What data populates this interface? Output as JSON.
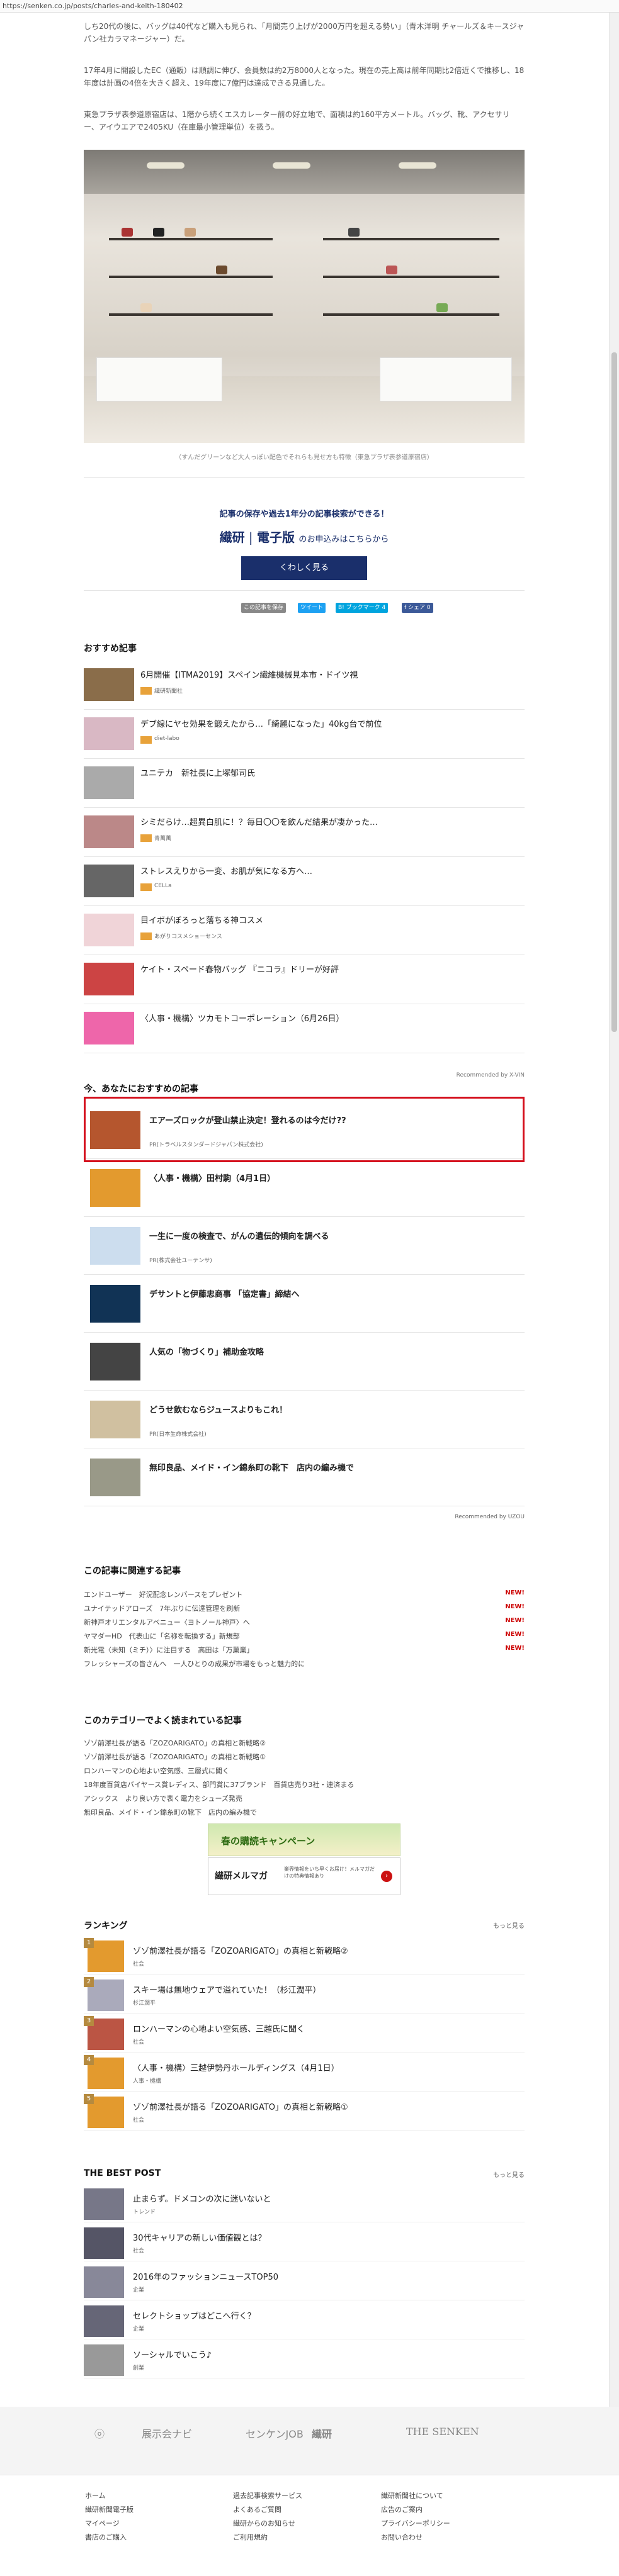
{
  "browser": {
    "url": "https://senken.co.jp/posts/charles-and-keith-180402"
  },
  "article": {
    "p1": "しち20代の後に、バッグは40代など購入も見られ、「月間売り上げが2000万円を超える勢い」（青木洋明 チャールズ＆キースジャパン社カラマネージャー）だ。",
    "p2": "17年4月に開設したEC（通販）は順調に伸び、会員数は約2万8000人となった。現在の売上高は前年同期比2倍近くで推移し、18年度は計画の4倍を大きく超え、19年度に7億円は達成できる見通した。",
    "p3": "東急プラザ表参道原宿店は、1階から続くエスカレーター前の好立地で、面積は約160平方メートル。バッグ、靴、アクセサリー、アイウエアで2405KU（在庫最小管理単位）を扱う。",
    "caption": "（すんだグリーンなど大人っぽい配色でそれらも見せ方も特徴（東急プラザ表参道原宿店）"
  },
  "promo": {
    "line1": "記事の保存や過去1年分の記事検索ができる！",
    "brand": "繊研",
    "brand2": "電子版",
    "line2_suffix": "のお申込みはこちらから",
    "button": "くわしく見る"
  },
  "share": {
    "scrap": "この記事を保存",
    "tweet": "ツイート",
    "hatena": "B! ブックマーク 4",
    "facebook": "f シェア 0"
  },
  "recommend": {
    "title": "おすすめ記事",
    "items": [
      {
        "title": "6月開催【ITMA2019】スペイン繊維機械見本市・ドイツ視",
        "src": "繊研新聞社"
      },
      {
        "title": "デブ線にヤセ効果を鍛えたから…「綺麗になった」40kg台で前位",
        "src": "diet-labo"
      },
      {
        "title": "ユニテカ　新社長に上塚郁司氏",
        "src": ""
      },
      {
        "title": "シミだらけ…超異白肌に！？毎日〇〇を飲んだ結果が凄かった…",
        "src": "青萬萬"
      },
      {
        "title": "ストレスえりから一変、お肌が気になる方へ…",
        "src": "CELLa"
      },
      {
        "title": "目イボがぼろっと落ちる神コスメ",
        "src": "あがりコスメショーセンス"
      },
      {
        "title": "ケイト・スペード春物バッグ 『ニコラ』ドリーが好評",
        "src": ""
      },
      {
        "title": "〈人事・機構〉ツカモトコーポレーション（6月26日）",
        "src": ""
      }
    ],
    "powered": "Recommended by  X-VIN"
  },
  "osusume": {
    "title": "今、あなたにおすすめの記事",
    "items": [
      {
        "title": "エアーズロックが登山禁止決定！登れるのは今だけ??",
        "pr": "PR(トラベルスタンダードジャパン株式会社)"
      },
      {
        "title": "〈人事・機構〉田村駒（4月1日）",
        "pr": ""
      },
      {
        "title": "一生に一度の検査で、がんの遺伝的傾向を調べる",
        "pr": "PR(株式会社ユーテンサ)"
      },
      {
        "title": "デサントと伊藤忠商事 「協定書」締結へ",
        "pr": ""
      },
      {
        "title": "人気の「物づくり」補助金攻略",
        "pr": ""
      },
      {
        "title": "どうせ飲むならジュースよりもこれ！",
        "pr": "PR(日本生命株式会社)"
      },
      {
        "title": "無印良品、メイド・イン錦糸町の靴下　店内の編み機で",
        "pr": ""
      }
    ],
    "powered": "Recommended by  UZOU"
  },
  "related": {
    "title": "この記事に関連する記事",
    "items": [
      {
        "text": "エンドユーザー　好況配念レンバースをプレゼント",
        "new": "NEW!"
      },
      {
        "text": "ユナイテッドアローズ　7年ぶりに伝達管理を刷新",
        "new": "NEW!"
      },
      {
        "text": "新神戸オリエンタルアベニュー〈ヨトノール神戸〉へ",
        "new": "NEW!"
      },
      {
        "text": "ヤマダーHD　代表山に「名称を転換する」新規部",
        "new": "NEW!"
      },
      {
        "text": "新光電〈未知（ミチ）〉に注目する　高田は「万菓業」",
        "new": "NEW!"
      },
      {
        "text": "フレッシャーズの皆さんへ　一人ひとりの成果が市場をもっと魅力的に",
        "new": ""
      }
    ]
  },
  "category": {
    "title": "このカテゴリーでよく読まれている記事",
    "items": [
      "ゾゾ前澤社長が語る「ZOZOARIGATO」の真相と新戦略②",
      "ゾゾ前澤社長が語る「ZOZOARIGATO」の真相と新戦略①",
      "ロンハーマンの心地よい空気感、三層式に聞く",
      "18年度百貨店バイヤース賞レディス、部門賞に37ブランド　百貨店売り3社・連済まる",
      "アシックス　より良い方で表く電力をシューズ発売",
      "無印良品、メイド・イン錦糸町の靴下　店内の編み機で"
    ]
  },
  "banners": {
    "b1": "春の購読キャンペーン",
    "b2a": "繊研メルマガ",
    "b2b": "業界情報をいち早くお届け！メルマガだけの特典情報あり"
  },
  "ranking": {
    "title": "ランキング",
    "more": "もっと見る",
    "items": [
      {
        "num": "1",
        "title": "ゾゾ前澤社長が語る「ZOZOARIGATO」の真相と新戦略②",
        "src": "社会"
      },
      {
        "num": "2",
        "title": "スキー場は無地ウェアで溢れていた！（杉江潤平）",
        "src": "杉江潤平"
      },
      {
        "num": "3",
        "title": "ロンハーマンの心地よい空気感、三越氏に聞く",
        "src": "社会"
      },
      {
        "num": "4",
        "title": "〈人事・機構〉三越伊勢丹ホールディングス（4月1日）",
        "src": "人事・機構"
      },
      {
        "num": "5",
        "title": "ゾゾ前澤社長が語る「ZOZOARIGATO」の真相と新戦略①",
        "src": "社会"
      }
    ]
  },
  "best": {
    "title": "THE BEST POST",
    "more": "もっと見る",
    "items": [
      {
        "title": "止まらず。ドメコンの次に迷いないと",
        "src": "トレンド"
      },
      {
        "title": "30代キャリアの新しい価値観とは？",
        "src": "社会"
      },
      {
        "title": "2016年のファッションニュースTOP50",
        "src": "企業"
      },
      {
        "title": "セレクトショップはどこへ行く？",
        "src": "企業"
      },
      {
        "title": "ソーシャルでいこう♪",
        "src": "創業"
      }
    ]
  },
  "footer": {
    "logos": [
      "展示会ナビ",
      "センケンJOB",
      "繊研",
      "THE SENKEN"
    ],
    "links": [
      [
        "ホーム",
        "繊研新聞電子版",
        "マイページ",
        "書店のご購入"
      ],
      [
        "過去記事検索サービス",
        "よくあるご質問",
        "繊研からのお知らせ",
        "ご利用規約"
      ],
      [
        "繊研新聞社について",
        "広告のご案内",
        "プライバシーポリシー",
        "お問い合わせ"
      ]
    ]
  },
  "colors": {
    "navy": "#1a2f6b",
    "highlight": "#d4101d",
    "rank": "#b58a3f"
  }
}
